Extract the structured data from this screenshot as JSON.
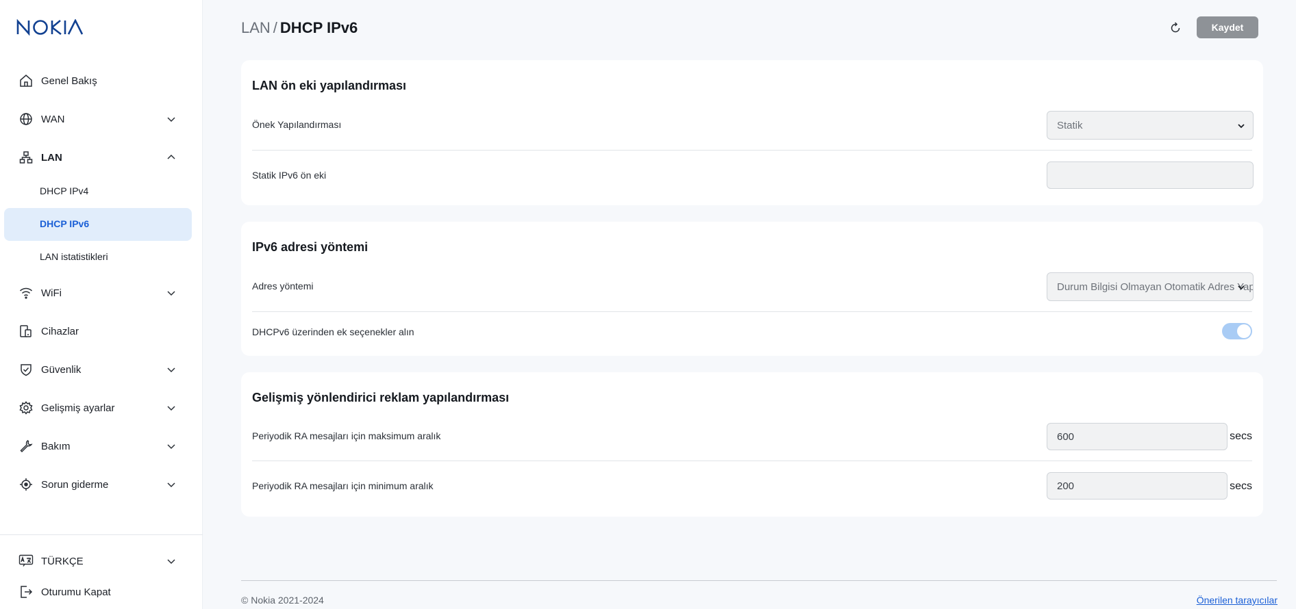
{
  "brand": {
    "name": "NOKIA",
    "color": "#124191"
  },
  "sidebar": {
    "items": [
      {
        "label": "Genel Bakış",
        "icon": "home-icon"
      },
      {
        "label": "WAN",
        "icon": "globe-icon"
      },
      {
        "label": "LAN",
        "icon": "network-icon"
      },
      {
        "label": "WiFi",
        "icon": "wifi-icon"
      },
      {
        "label": "Cihazlar",
        "icon": "devices-icon"
      },
      {
        "label": "Güvenlik",
        "icon": "shield-icon"
      },
      {
        "label": "Gelişmiş ayarlar",
        "icon": "gear-icon"
      },
      {
        "label": "Bakım",
        "icon": "wrench-icon"
      },
      {
        "label": "Sorun giderme",
        "icon": "target-icon"
      }
    ],
    "lan_subitems": [
      {
        "label": "DHCP IPv4"
      },
      {
        "label": "DHCP IPv6"
      },
      {
        "label": "LAN istatistikleri"
      }
    ],
    "language": {
      "label": "TÜRKÇE",
      "icon": "translate-icon"
    },
    "logout": {
      "label": "Oturumu Kapat",
      "icon": "logout-icon"
    }
  },
  "header": {
    "breadcrumb_parent": "LAN",
    "breadcrumb_sep": "/",
    "breadcrumb_current": "DHCP IPv6",
    "save_label": "Kaydet"
  },
  "sections": {
    "prefix": {
      "title": "LAN ön eki yapılandırması",
      "config_label": "Önek Yapılandırması",
      "config_value": "Statik",
      "static_label": "Statik IPv6 ön eki",
      "static_value": ""
    },
    "address": {
      "title": "IPv6 adresi yöntemi",
      "method_label": "Adres yöntemi",
      "method_value": "Durum Bilgisi Olmayan Otomatik Adres Yapılandırması",
      "dhcp_options_label": "DHCPv6 üzerinden ek seçenekler alın",
      "dhcp_options_enabled": true
    },
    "router_adv": {
      "title": "Gelişmiş yönlendirici reklam yapılandırması",
      "max_label": "Periyodik RA mesajları için maksimum aralık",
      "max_value": "600",
      "min_label": "Periyodik RA mesajları için minimum aralık",
      "min_value": "200",
      "unit": "secs"
    }
  },
  "footer": {
    "copyright": "© Nokia 2021-2024",
    "browsers_link": "Önerilen tarayıcılar"
  }
}
